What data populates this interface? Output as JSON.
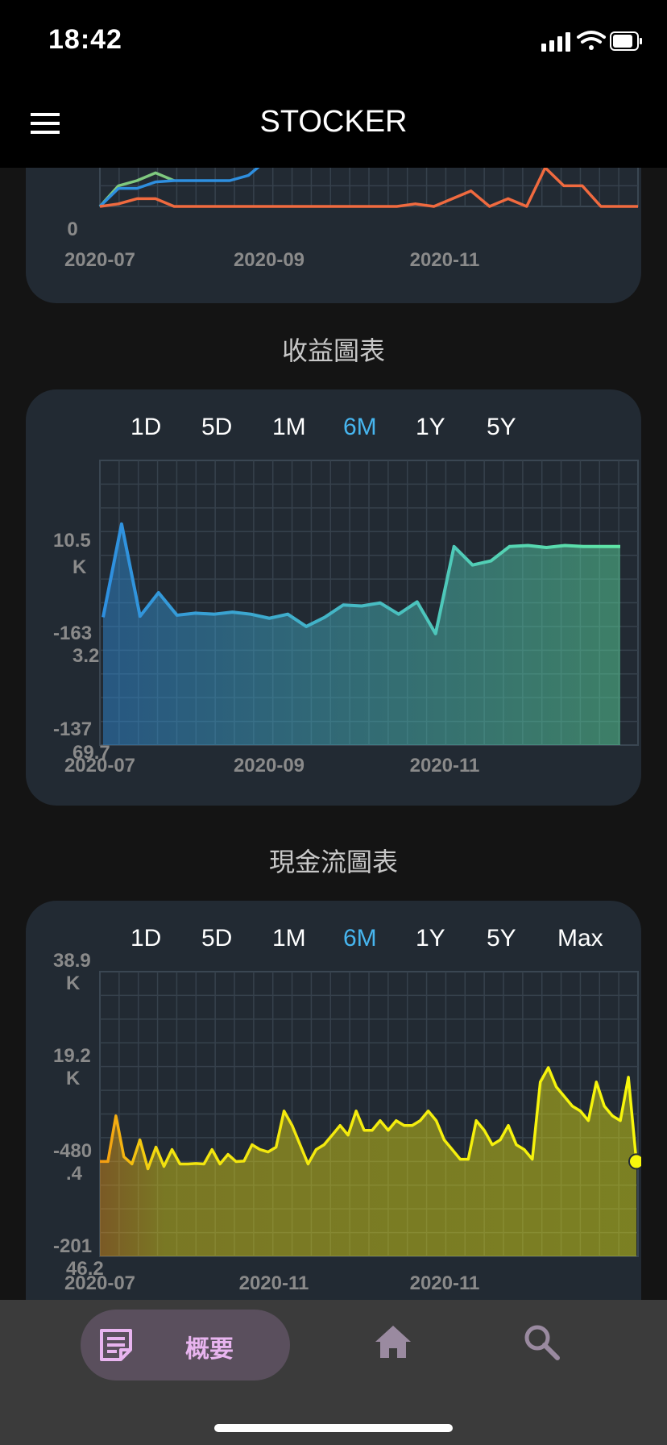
{
  "status_bar": {
    "time": "18:42"
  },
  "header": {
    "title": "STOCKER"
  },
  "top_chart": {
    "y_tick_labels": [
      "0"
    ],
    "x_tick_labels": [
      "2020-07",
      "2020-09",
      "2020-11"
    ]
  },
  "income_section": {
    "title": "收益圖表"
  },
  "cashflow_section": {
    "title": "現金流圖表"
  },
  "income_tabs": [
    "1D",
    "5D",
    "1M",
    "6M",
    "1Y",
    "5Y"
  ],
  "cashflow_tabs": [
    "1D",
    "5D",
    "1M",
    "6M",
    "1Y",
    "5Y",
    "Max"
  ],
  "active_tab": "6M",
  "bottom_nav": {
    "summary_label": "概要"
  },
  "colors": {
    "background": "#141414",
    "card": "#222a33",
    "active_tab": "#47b6f0",
    "nav_accent": "#e8b4ef"
  },
  "chart_data": [
    {
      "type": "line",
      "x_tick_labels": [
        "2020-07",
        "2020-09",
        "2020-11"
      ],
      "y_tick_labels": [
        "0"
      ],
      "series": [
        {
          "values": [
            0,
            0.8,
            1.0,
            1.3,
            1.0
          ],
          "color": "#7fc97f"
        },
        {
          "values": [
            0,
            0.7,
            0.7,
            0.95,
            1.0,
            1.0,
            1.0,
            1.0,
            1.2,
            1.8
          ],
          "color": "#2e8fe0"
        },
        {
          "values": [
            0,
            0.1,
            0.3,
            0.3,
            0,
            0,
            0,
            0,
            0,
            0,
            0,
            0,
            0,
            0,
            0,
            0,
            0,
            0.1,
            0,
            0.3,
            0.6,
            0,
            0.3,
            0,
            1.5,
            0.8,
            0.8,
            0,
            0,
            0
          ],
          "color": "#f06a3f"
        }
      ]
    },
    {
      "type": "area",
      "y_tick_labels": [
        "10.5K",
        "-1633.2",
        "-13769.7"
      ],
      "x_tick_labels": [
        "2020-07",
        "2020-09",
        "2020-11"
      ],
      "ylim": [
        -13769.7,
        14000
      ],
      "values": [
        -1300,
        7800,
        -1200,
        1100,
        -1100,
        -900,
        -1000,
        -800,
        -1000,
        -1400,
        -1000,
        -2200,
        -1300,
        -100,
        -200,
        100,
        -1000,
        200,
        -2900,
        5600,
        3800,
        4200,
        5600,
        5700,
        5500,
        5700,
        5600,
        5600,
        5600
      ]
    },
    {
      "type": "area",
      "y_tick_labels": [
        "38.9K",
        "19.2K",
        "-480.4",
        "-20146.2"
      ],
      "x_tick_labels": [
        "2020-07",
        "2020-11",
        "2020-11"
      ],
      "ylim": [
        -20146.2,
        38900
      ],
      "values": [
        -480,
        -480,
        9000,
        500,
        -1000,
        4000,
        -2000,
        2500,
        -1500,
        2000,
        -1000,
        -1000,
        -900,
        -1000,
        2000,
        -1000,
        1000,
        -500,
        -400,
        3000,
        2000,
        1500,
        2500,
        10000,
        7000,
        3000,
        -1000,
        2000,
        3000,
        5000,
        7000,
        5000,
        10000,
        6000,
        6000,
        8000,
        6000,
        8000,
        7000,
        7000,
        8000,
        10000,
        8000,
        4000,
        2000,
        0,
        0,
        8000,
        6000,
        3000,
        4000,
        7000,
        3000,
        2000,
        0,
        16000,
        19000,
        15000,
        13000,
        11000,
        10000,
        8000,
        16000,
        11000,
        9000,
        8000,
        17000,
        -480
      ]
    }
  ]
}
